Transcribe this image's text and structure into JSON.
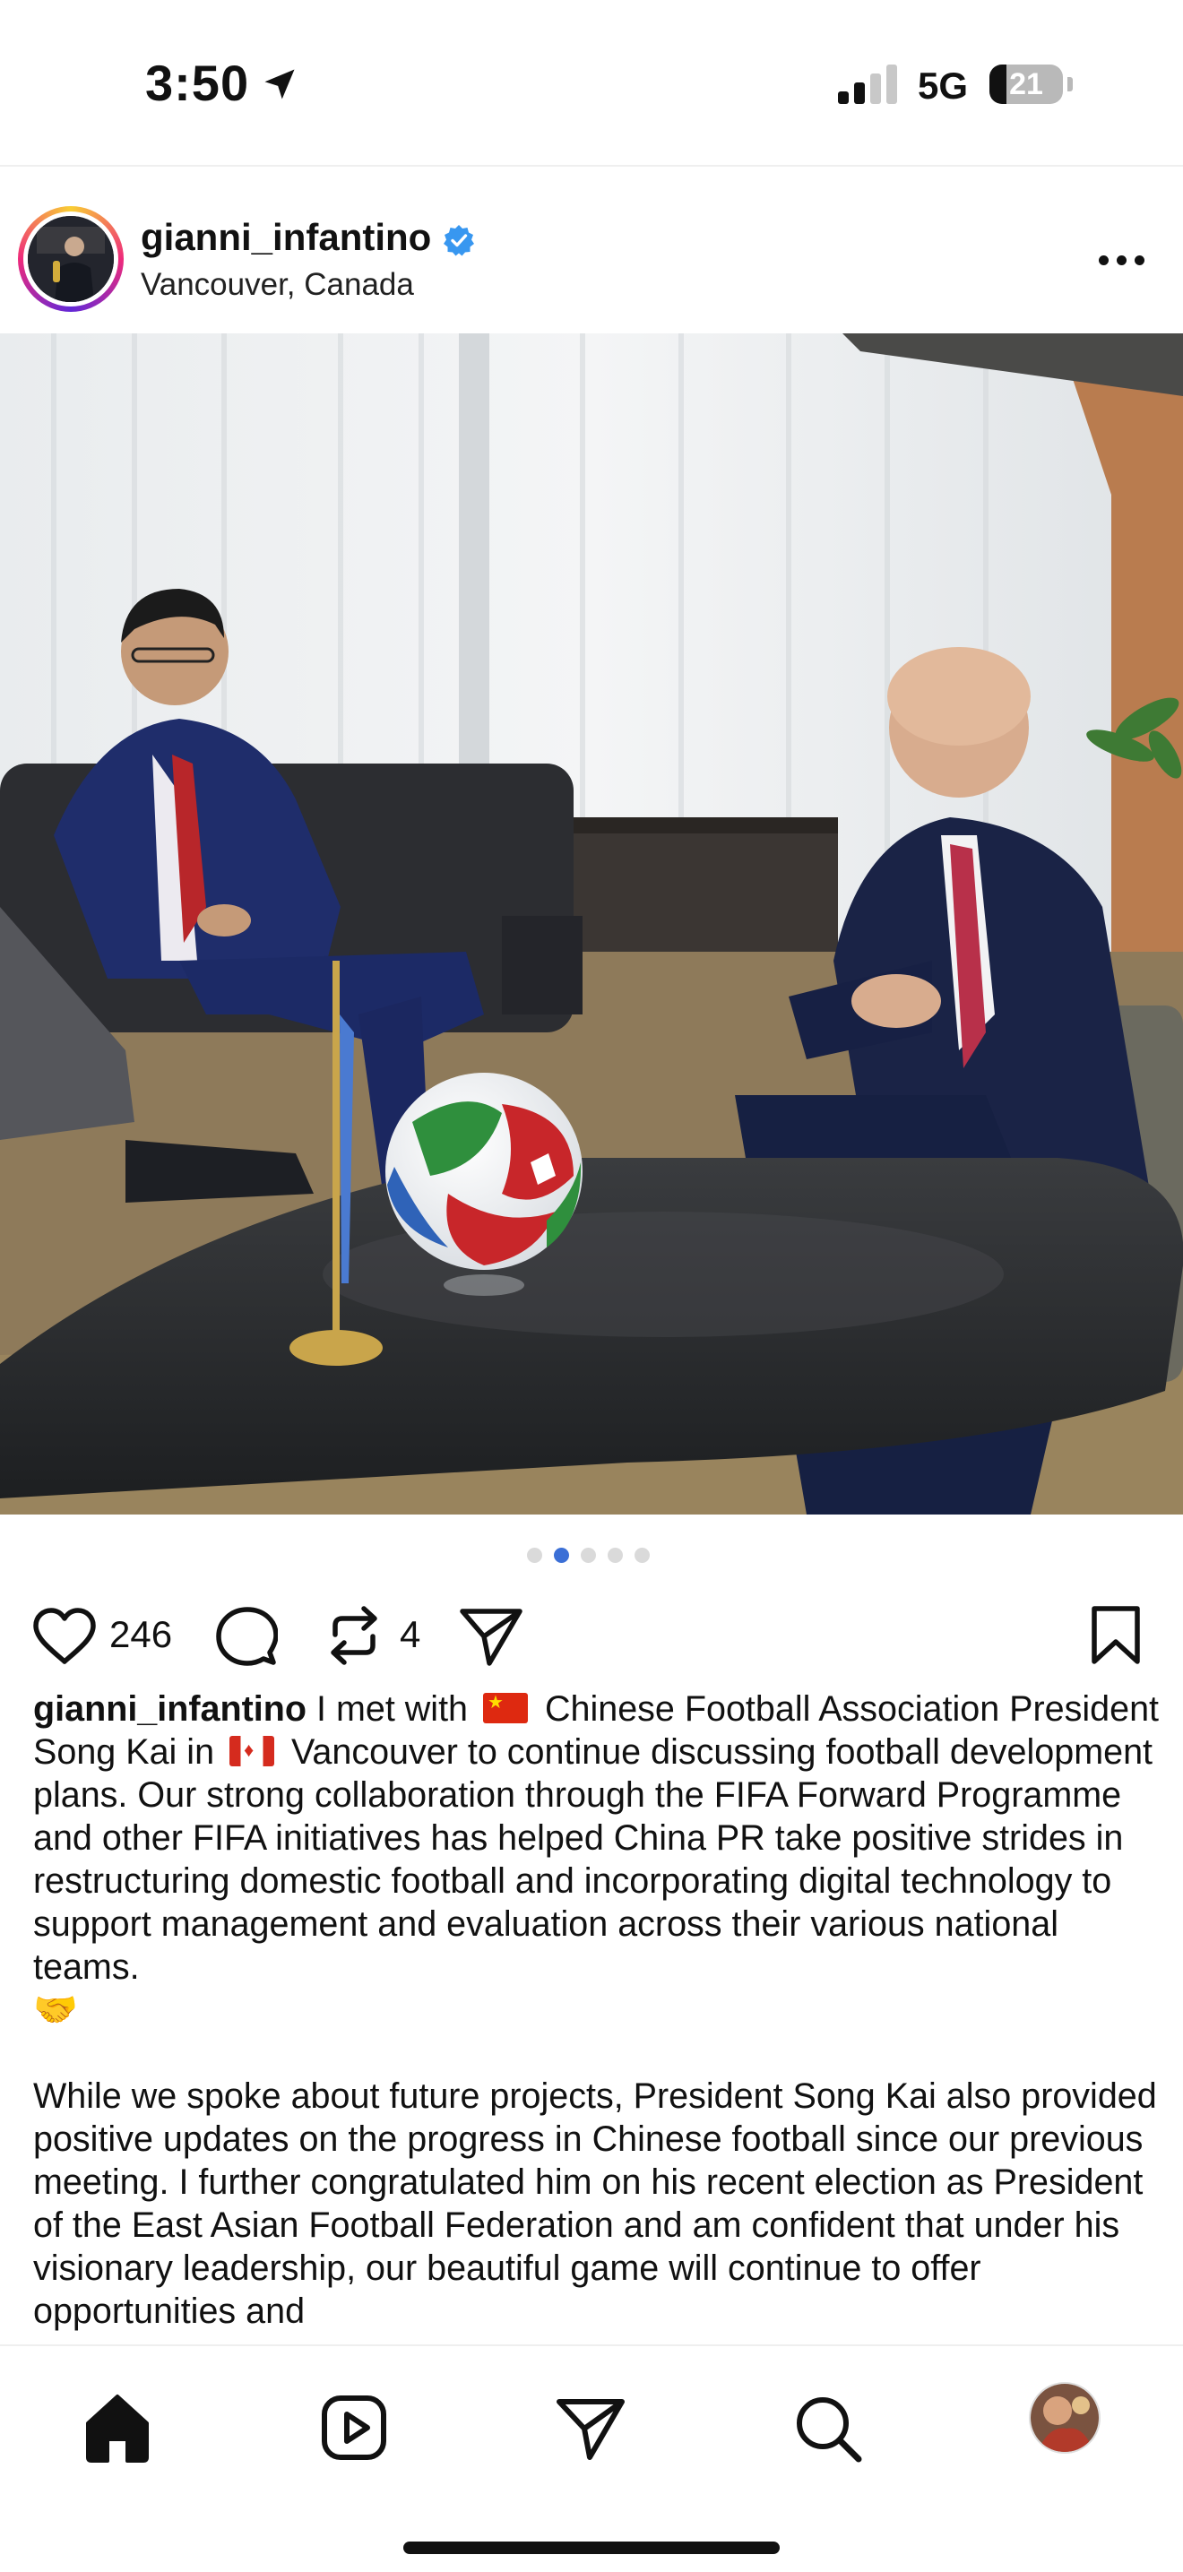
{
  "status_bar": {
    "time": "3:50",
    "network": "5G",
    "battery": "21",
    "battery_level": 0.21
  },
  "post": {
    "username": "gianni_infantino",
    "location": "Vancouver, Canada",
    "verified": true,
    "carousel": {
      "total": 5,
      "active_index": 1
    },
    "likes": "246",
    "reposts": "4"
  },
  "caption": {
    "username": "gianni_infantino",
    "p1_a": "I met with",
    "p1_b": "Chinese Football Association President Song Kai in",
    "p1_c": "Vancouver to continue discussing football development plans. Our strong collaboration through the FIFA Forward Programme and other FIFA initiatives has helped China PR take positive strides in restructuring domestic football and incorporating digital technology to support management and evaluation across their various national teams.",
    "p2": "While we spoke about future projects, President Song Kai also provided positive updates on the progress in Chinese football since our previous meeting. I further congratulated him on his recent election as President of the East Asian Football Federation and am confident that under his visionary leadership, our beautiful game will continue to offer opportunities and"
  },
  "icons": {
    "location_arrow": "location-arrow-icon",
    "verified": "verified-badge-icon",
    "more": "more-options-icon",
    "like": "heart-icon",
    "comment": "comment-icon",
    "repost": "repost-icon",
    "share": "send-icon",
    "save": "bookmark-icon",
    "nav": [
      "home-icon",
      "reels-icon",
      "send-icon",
      "search-icon",
      "profile-avatar"
    ]
  },
  "colors": {
    "verified": "#3897f0",
    "active_dot": "#3b6fd6",
    "inactive_dot": "#dadada"
  }
}
